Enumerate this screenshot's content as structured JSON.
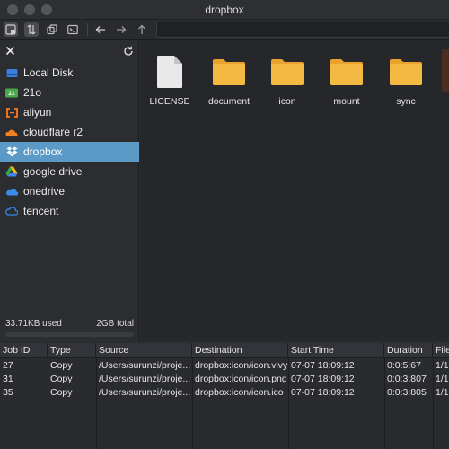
{
  "window": {
    "title": "dropbox"
  },
  "sidebar": {
    "items": [
      {
        "label": "Local Disk",
        "icon": "local-disk-icon",
        "color": "#3d7fe0"
      },
      {
        "label": "21o",
        "icon": "21o-icon",
        "color": "#4aa84a"
      },
      {
        "label": "aliyun",
        "icon": "aliyun-icon",
        "color": "#ff7a1a"
      },
      {
        "label": "cloudflare r2",
        "icon": "cloudflare-icon",
        "color": "#f38020"
      },
      {
        "label": "dropbox",
        "icon": "dropbox-icon",
        "color": "#ffffff"
      },
      {
        "label": "google drive",
        "icon": "google-drive-icon",
        "color": "#34a853"
      },
      {
        "label": "onedrive",
        "icon": "onedrive-icon",
        "color": "#3b8be8"
      },
      {
        "label": "tencent",
        "icon": "tencent-icon",
        "color": "#2d8cf0"
      }
    ],
    "selected": "dropbox",
    "usage": {
      "used": "33.71KB used",
      "total": "2GB total",
      "fraction": 0.0
    }
  },
  "files": [
    {
      "name": "LICENSE",
      "type": "file"
    },
    {
      "name": "document",
      "type": "folder"
    },
    {
      "name": "icon",
      "type": "folder"
    },
    {
      "name": "mount",
      "type": "folder"
    },
    {
      "name": "sync",
      "type": "folder"
    }
  ],
  "jobs": {
    "columns": [
      "Job ID",
      "Type",
      "Source",
      "Destination",
      "Start Time",
      "Duration",
      "File"
    ],
    "rows": [
      [
        "27",
        "Copy",
        "/Users/surunzi/proje...",
        "dropbox:icon/icon.vivy",
        "07-07 18:09:12",
        "0:0:5:67",
        "1/1"
      ],
      [
        "31",
        "Copy",
        "/Users/surunzi/proje...",
        "dropbox:icon/icon.png",
        "07-07 18:09:12",
        "0:0:3:807",
        "1/1"
      ],
      [
        "35",
        "Copy",
        "/Users/surunzi/proje...",
        "dropbox:icon/icon.ico",
        "07-07 18:09:12",
        "0:0:3:805",
        "1/1"
      ]
    ]
  },
  "colors": {
    "selection": "#5b9ac7",
    "folder": "#f4b942"
  }
}
